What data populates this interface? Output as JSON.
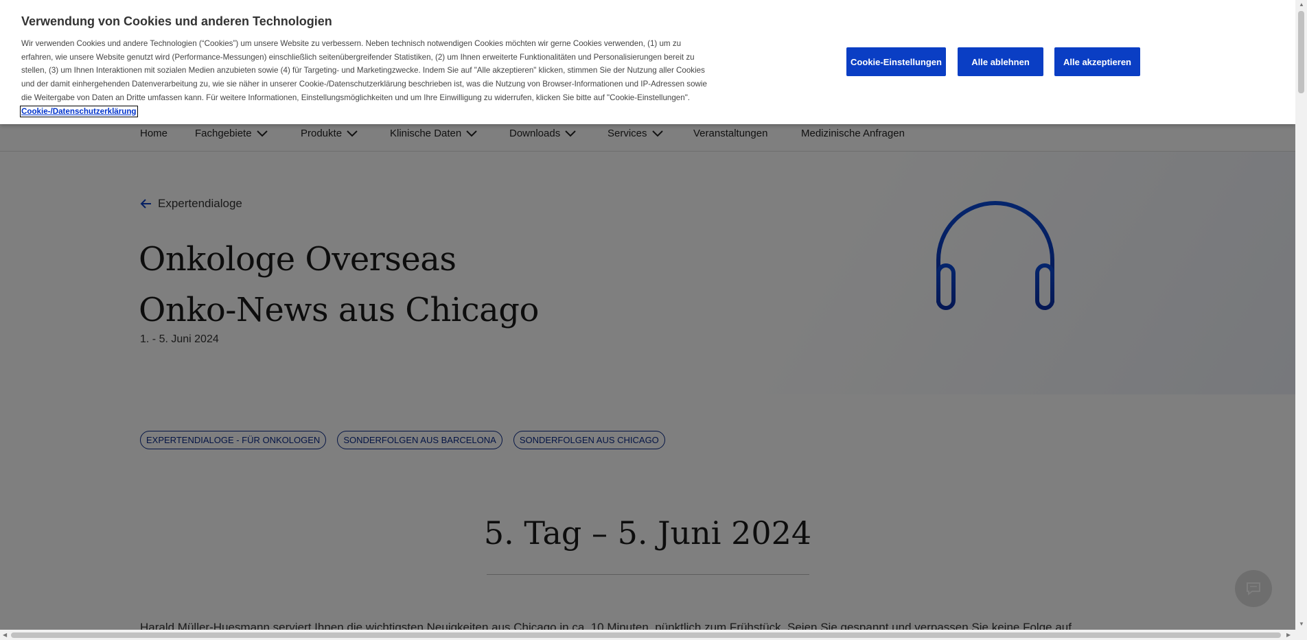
{
  "nav": {
    "items": [
      {
        "label": "Home",
        "has_dropdown": false
      },
      {
        "label": "Fachgebiete",
        "has_dropdown": true
      },
      {
        "label": "Produkte",
        "has_dropdown": true
      },
      {
        "label": "Klinische Daten",
        "has_dropdown": true
      },
      {
        "label": "Downloads",
        "has_dropdown": true
      },
      {
        "label": "Services",
        "has_dropdown": true
      },
      {
        "label": "Veranstaltungen",
        "has_dropdown": false
      },
      {
        "label": "Medizinische Anfragen",
        "has_dropdown": false
      }
    ]
  },
  "hero": {
    "back_label": "Expertendialoge",
    "title_line1": "Onkologe Overseas",
    "title_line2": "Onko-News aus Chicago",
    "date": "1. - 5. Juni 2024",
    "icon": "headphones-icon",
    "accent_color": "#0a3ec4"
  },
  "tags": [
    "EXPERTENDIALOGE - FÜR ONKOLOGEN",
    "SONDERFOLGEN AUS BARCELONA",
    "SONDERFOLGEN AUS CHICAGO"
  ],
  "day_section": {
    "title": "5. Tag – 5. Juni 2024",
    "intro": "Harald Müller-Huesmann serviert Ihnen die wichtigsten Neuigkeiten aus Chicago in ca. 10 Minuten, pünktlich zum Frühstück. Seien Sie gespannt und verpassen Sie keine Folge auf"
  },
  "cookie_banner": {
    "title": "Verwendung von Cookies und anderen Technologien",
    "text": "Wir verwenden Cookies und andere Technologien (“Cookies”) um unsere Website zu verbessern. Neben technisch notwendigen Cookies möchten wir gerne Cookies verwenden, (1) um zu erfahren, wie unsere Website genutzt wird (Performance-Messungen) einschließlich seitenübergreifender Statistiken, (2) um Ihnen erweiterte Funktionalitäten und Personalisierungen bereit zu stellen, (3) um Ihnen Interaktionen mit sozialen Medien anzubieten sowie (4) für Targeting- und Marketingzwecke. Indem Sie auf \"Alle akzeptieren\" klicken, stimmen Sie der Nutzung aller Cookies und der damit einhergehenden Datenverarbeitung zu, wie sie näher in unserer Cookie-/Datenschutzerklärung beschrieben ist, was die Nutzung von Browser-Informationen und IP-Adressen sowie die Weitergabe von Daten an Dritte umfassen kann. Für weitere Informationen, Einstellungsmöglichkeiten und um Ihre Einwilligung zu widerrufen, klicken Sie bitte auf \"Cookie-Einstellungen\". ",
    "link_label": "Cookie-/Datenschutzerklärung",
    "buttons": {
      "settings": "Cookie-Einstellungen",
      "reject": "Alle ablehnen",
      "accept": "Alle akzeptieren"
    },
    "button_color": "#0a3ec4"
  },
  "chat": {
    "icon": "chat-icon"
  }
}
